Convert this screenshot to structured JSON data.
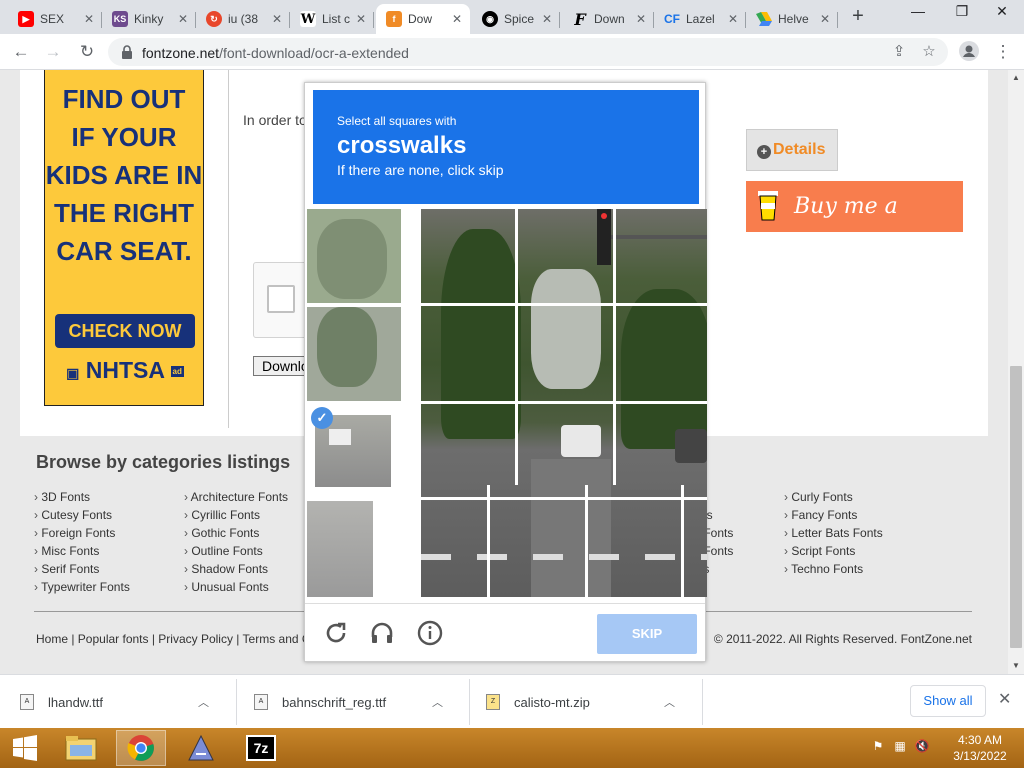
{
  "tabs": [
    {
      "title": "SEX",
      "favicon": "youtube-icon",
      "color": "#ff0000"
    },
    {
      "title": "Kinky",
      "favicon": "ks-icon",
      "color": "#6e4b8e"
    },
    {
      "title": "iu (38",
      "favicon": "refresh-tab-icon",
      "color": "#e8472b"
    },
    {
      "title": "List c",
      "favicon": "wikipedia-icon",
      "color": "#000000"
    },
    {
      "title": "Dow",
      "favicon": "fontzone-icon",
      "color": "#f08b26"
    },
    {
      "title": "Spice",
      "favicon": "github-icon",
      "color": "#000000"
    },
    {
      "title": "Down",
      "favicon": "font-f-icon",
      "color": "#000000"
    },
    {
      "title": "Lazel",
      "favicon": "cf-icon",
      "color": "#1a73e8"
    },
    {
      "title": "Helve",
      "favicon": "drive-icon",
      "color": "#34a853"
    }
  ],
  "address": {
    "domain": "fontzone.net",
    "path": "/font-download/ocr-a-extended"
  },
  "ad": {
    "headline": "FIND OUT\nIF YOUR\nKIDS ARE IN\nTHE RIGHT\nCAR SEAT.",
    "button": "CHECK NOW",
    "logo": "NHTSA",
    "logo_tag": "ad"
  },
  "content": {
    "order_text": "In order to",
    "download_label": "Downlo",
    "details_label": "Details",
    "coffee_label": "Buy me a coffee"
  },
  "captcha": {
    "instruction_small": "Select all squares with",
    "target": "crosswalks",
    "instruction_sub": "If there are none, click skip",
    "skip_label": "SKIP"
  },
  "footer": {
    "title": "Browse by categories listings",
    "col1": [
      "3D Fonts",
      "Cutesy Fonts",
      "Foreign Fonts",
      "Misc Fonts",
      "Serif Fonts",
      "Typewriter Fonts"
    ],
    "col2": [
      "Architecture Fonts",
      "Cyrillic Fonts",
      "Gothic Fonts",
      "Outline Fonts",
      "Shadow Fonts",
      "Unusual Fonts"
    ],
    "col3": [
      "ts",
      "Fonts",
      "Fonts",
      "s"
    ],
    "col4": [
      "Curly Fonts",
      "Fancy Fonts",
      "Letter Bats Fonts",
      "Script Fonts",
      "Techno Fonts"
    ],
    "links": "Home | Popular fonts | Privacy Policy | Terms and C",
    "copyright": "© 2011-2022. All Rights Reserved. FontZone.net"
  },
  "downloads": [
    {
      "name": "lhandw.ttf"
    },
    {
      "name": "bahnschrift_reg.ttf"
    },
    {
      "name": "calisto-mt.zip"
    }
  ],
  "download_bar": {
    "show_all": "Show all"
  },
  "clock": {
    "time": "4:30 AM",
    "date": "3/13/2022"
  }
}
